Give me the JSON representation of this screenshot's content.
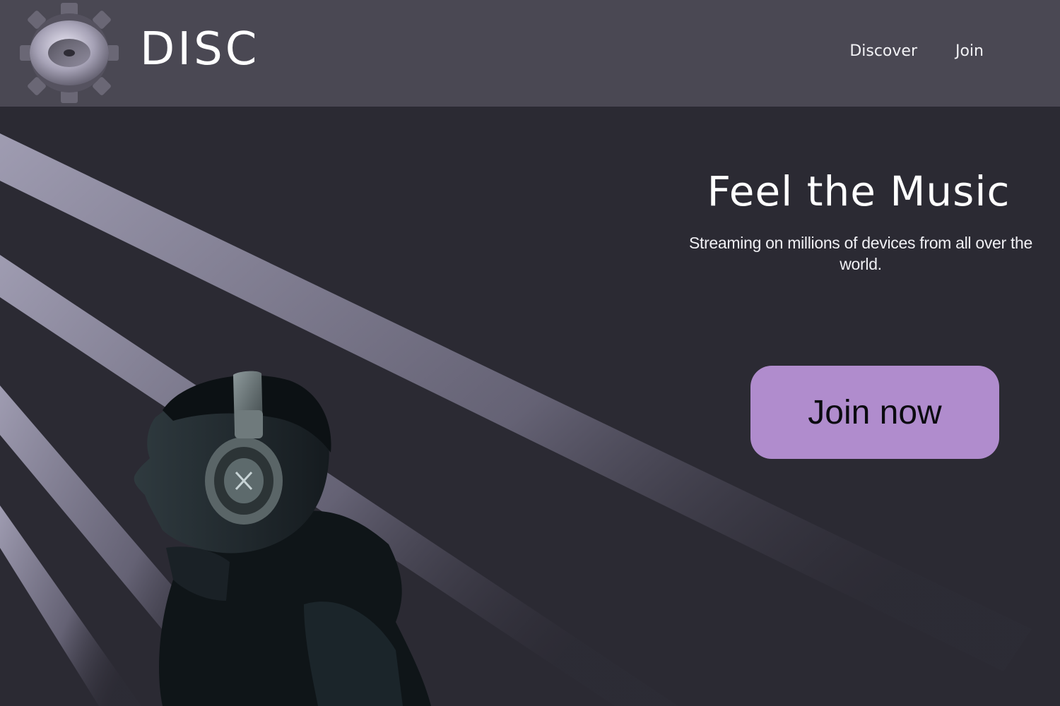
{
  "brand": {
    "name": "DISC",
    "logo_icon": "vinyl-disc-icon"
  },
  "nav": {
    "items": [
      {
        "label": "Discover"
      },
      {
        "label": "Join"
      }
    ]
  },
  "hero": {
    "title": "Feel the Music",
    "subtitle": "Streaming on millions of devices from all over the world.",
    "cta_label": "Join now",
    "image": "person-with-headphones"
  },
  "colors": {
    "header_bg": "#4a4853",
    "page_bg": "#2b2a33",
    "cta_bg": "#b08ccd",
    "beam": "#9f9cb3"
  }
}
